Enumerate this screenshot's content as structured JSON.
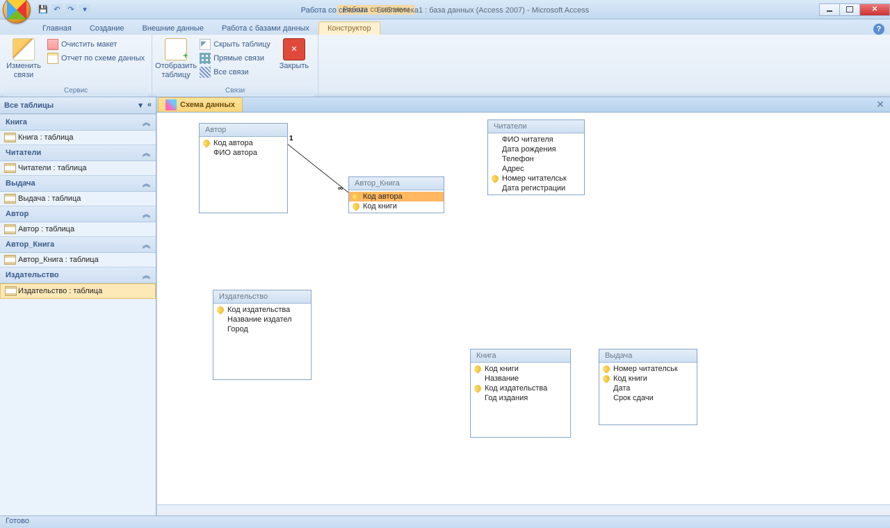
{
  "window": {
    "ctx_category": "Работа со связями",
    "title": "Библиотека1 : база данных (Access 2007)  -  Microsoft Access"
  },
  "tabs": [
    "Главная",
    "Создание",
    "Внешние данные",
    "Работа с базами данных"
  ],
  "ctx_tab": "Конструктор",
  "ribbon": {
    "group1": {
      "big": "Изменить\nсвязи",
      "clear": "Очистить макет",
      "report": "Отчет по схеме данных",
      "label": "Сервис"
    },
    "group2": {
      "big": "Отобразить\nтаблицу",
      "hide": "Скрыть таблицу",
      "direct": "Прямые связи",
      "all": "Все связи",
      "label": "Связи"
    },
    "group3": {
      "big": "Закрыть"
    }
  },
  "nav": {
    "header": "Все таблицы",
    "groups": [
      {
        "name": "Книга",
        "items": [
          "Книга : таблица"
        ]
      },
      {
        "name": "Читатели",
        "items": [
          "Читатели : таблица"
        ]
      },
      {
        "name": "Выдача",
        "items": [
          "Выдача : таблица"
        ]
      },
      {
        "name": "Автор",
        "items": [
          "Автор : таблица"
        ]
      },
      {
        "name": "Автор_Книга",
        "items": [
          "Автор_Книга : таблица"
        ]
      },
      {
        "name": "Издательство",
        "items": [
          "Издательство : таблица"
        ],
        "selected": true
      }
    ]
  },
  "doc_tab": "Схема данных",
  "tables": {
    "t_avtor": {
      "title": "Автор",
      "fields": [
        {
          "n": "Код автора",
          "k": true
        },
        {
          "n": "ФИО автора"
        }
      ]
    },
    "t_ak": {
      "title": "Автор_Книга",
      "fields": [
        {
          "n": "Код автора",
          "k": true,
          "sel": true
        },
        {
          "n": "Код книги",
          "k": true
        }
      ]
    },
    "t_chit": {
      "title": "Читатели",
      "fields": [
        {
          "n": "ФИО читателя"
        },
        {
          "n": "Дата рождения"
        },
        {
          "n": "Телефон"
        },
        {
          "n": "Адрес"
        },
        {
          "n": "Номер  читателськ",
          "k": true
        },
        {
          "n": "Дата регистрации"
        }
      ]
    },
    "t_izd": {
      "title": "Издательство",
      "fields": [
        {
          "n": "Код издательства",
          "k": true
        },
        {
          "n": "Название издател"
        },
        {
          "n": "Город"
        }
      ]
    },
    "t_kniga": {
      "title": "Книга",
      "fields": [
        {
          "n": "Код книги",
          "k": true
        },
        {
          "n": "Название"
        },
        {
          "n": "Код издательства",
          "k": true
        },
        {
          "n": "Год издания"
        }
      ]
    },
    "t_vyd": {
      "title": "Выдача",
      "fields": [
        {
          "n": "Номер читателськ",
          "k": true
        },
        {
          "n": "Код книги",
          "k": true
        },
        {
          "n": "Дата"
        },
        {
          "n": "Срок сдачи"
        }
      ]
    }
  },
  "status": "Готово"
}
